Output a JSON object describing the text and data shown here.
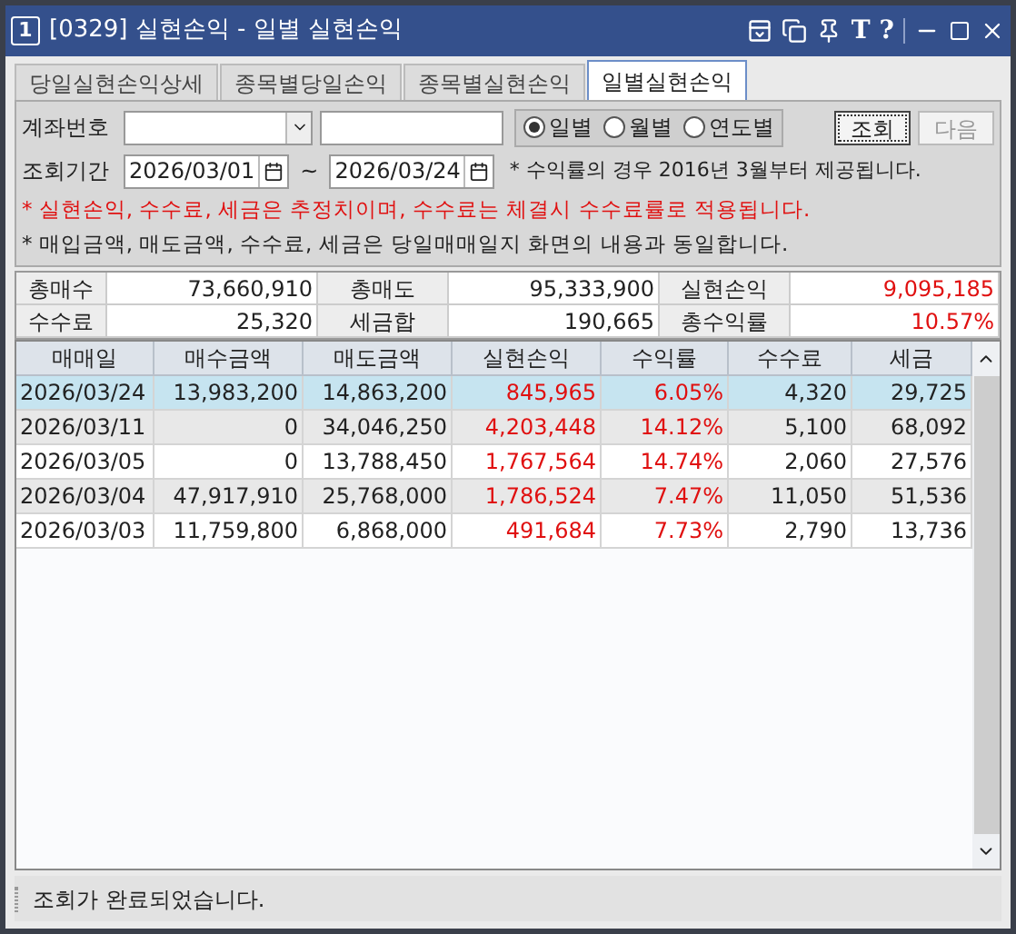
{
  "window": {
    "number": "1",
    "title": "[0329] 실현손익 - 일별 실현손익",
    "tool_buttons": [
      "T",
      "?"
    ]
  },
  "tabs": [
    {
      "label": "당일실현손익상세",
      "selected": false
    },
    {
      "label": "종목별당일손익",
      "selected": false
    },
    {
      "label": "종목별실현손익",
      "selected": false
    },
    {
      "label": "일별실현손익",
      "selected": true
    }
  ],
  "account": {
    "label": "계좌번호"
  },
  "periods": [
    {
      "label": "일별",
      "selected": true
    },
    {
      "label": "월별",
      "selected": false
    },
    {
      "label": "연도별",
      "selected": false
    }
  ],
  "buttons": [
    {
      "label": "조회",
      "disabled": false
    },
    {
      "label": "다음",
      "disabled": true
    }
  ],
  "range": {
    "label": "조회기간",
    "from": "2026/03/01",
    "separator": "~",
    "to": "2026/03/24",
    "note": "* 수익률의 경우 2016년 3월부터 제공됩니다."
  },
  "notices": [
    {
      "text": "* 실현손익, 수수료, 세금은 추정치이며, 수수료는 체결시 수수료률로 적용됩니다.",
      "warning": true
    },
    {
      "text": "* 매입금액, 매도금액, 수수료, 세금은 당일매매일지 화면의 내용과 동일합니다.",
      "warning": false
    }
  ],
  "summary": [
    [
      {
        "label": "총매수",
        "value": "73,660,910",
        "gain": false
      },
      {
        "label": "총매도",
        "value": "95,333,900",
        "gain": false
      },
      {
        "label": "실현손익",
        "value": "9,095,185",
        "gain": true
      }
    ],
    [
      {
        "label": "수수료",
        "value": "25,320",
        "gain": false
      },
      {
        "label": "세금합",
        "value": "190,665",
        "gain": false
      },
      {
        "label": "총수익률",
        "value": "10.57%",
        "gain": true
      }
    ]
  ],
  "table": {
    "columns": [
      "매매일",
      "매수금액",
      "매도금액",
      "실현손익",
      "수익률",
      "수수료",
      "세금"
    ],
    "rows": [
      {
        "selected": true,
        "gain": true,
        "cells": [
          "2026/03/24",
          "13,983,200",
          "14,863,200",
          "845,965",
          "6.05%",
          "4,320",
          "29,725"
        ]
      },
      {
        "selected": false,
        "gain": true,
        "cells": [
          "2026/03/11",
          "0",
          "34,046,250",
          "4,203,448",
          "14.12%",
          "5,100",
          "68,092"
        ]
      },
      {
        "selected": false,
        "gain": true,
        "cells": [
          "2026/03/05",
          "0",
          "13,788,450",
          "1,767,564",
          "14.74%",
          "2,060",
          "27,576"
        ]
      },
      {
        "selected": false,
        "gain": true,
        "cells": [
          "2026/03/04",
          "47,917,910",
          "25,768,000",
          "1,786,524",
          "7.47%",
          "11,050",
          "51,536"
        ]
      },
      {
        "selected": false,
        "gain": true,
        "cells": [
          "2026/03/03",
          "11,759,800",
          "6,868,000",
          "491,684",
          "7.73%",
          "2,790",
          "13,736"
        ]
      }
    ]
  },
  "status_bar": {
    "text": "조회가 완료되었습니다."
  }
}
